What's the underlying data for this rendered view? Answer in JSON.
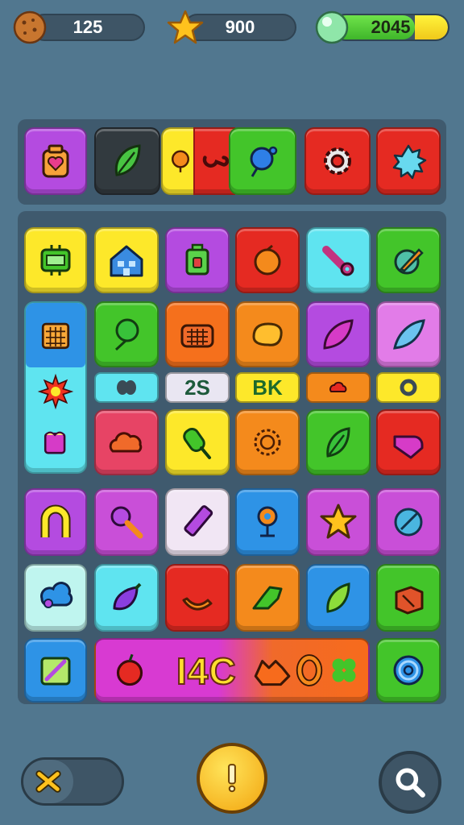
{
  "hud": {
    "coins": "125",
    "stars": "900",
    "energy": "2045",
    "energy_fill": 0.71
  },
  "board": {
    "counter_chip": "2S",
    "bk_chip": "BK",
    "combo_text": "I4C"
  },
  "icons": {
    "coin": "cookie-coin-icon",
    "star": "star-icon",
    "gem": "green-gem-icon",
    "shuffle": "shuffle-icon",
    "hint": "exclamation-icon",
    "search": "magnifier-icon"
  },
  "colors": {
    "background": "#51778f",
    "panel": "#3f5a6e",
    "purple": "#b44be0",
    "yellow": "#fde82a",
    "red": "#e52a22",
    "green": "#43c52a",
    "orange": "#f48a1c",
    "cyan": "#5fe4f0",
    "magenta": "#c94fd8",
    "blue": "#2e93e6"
  }
}
